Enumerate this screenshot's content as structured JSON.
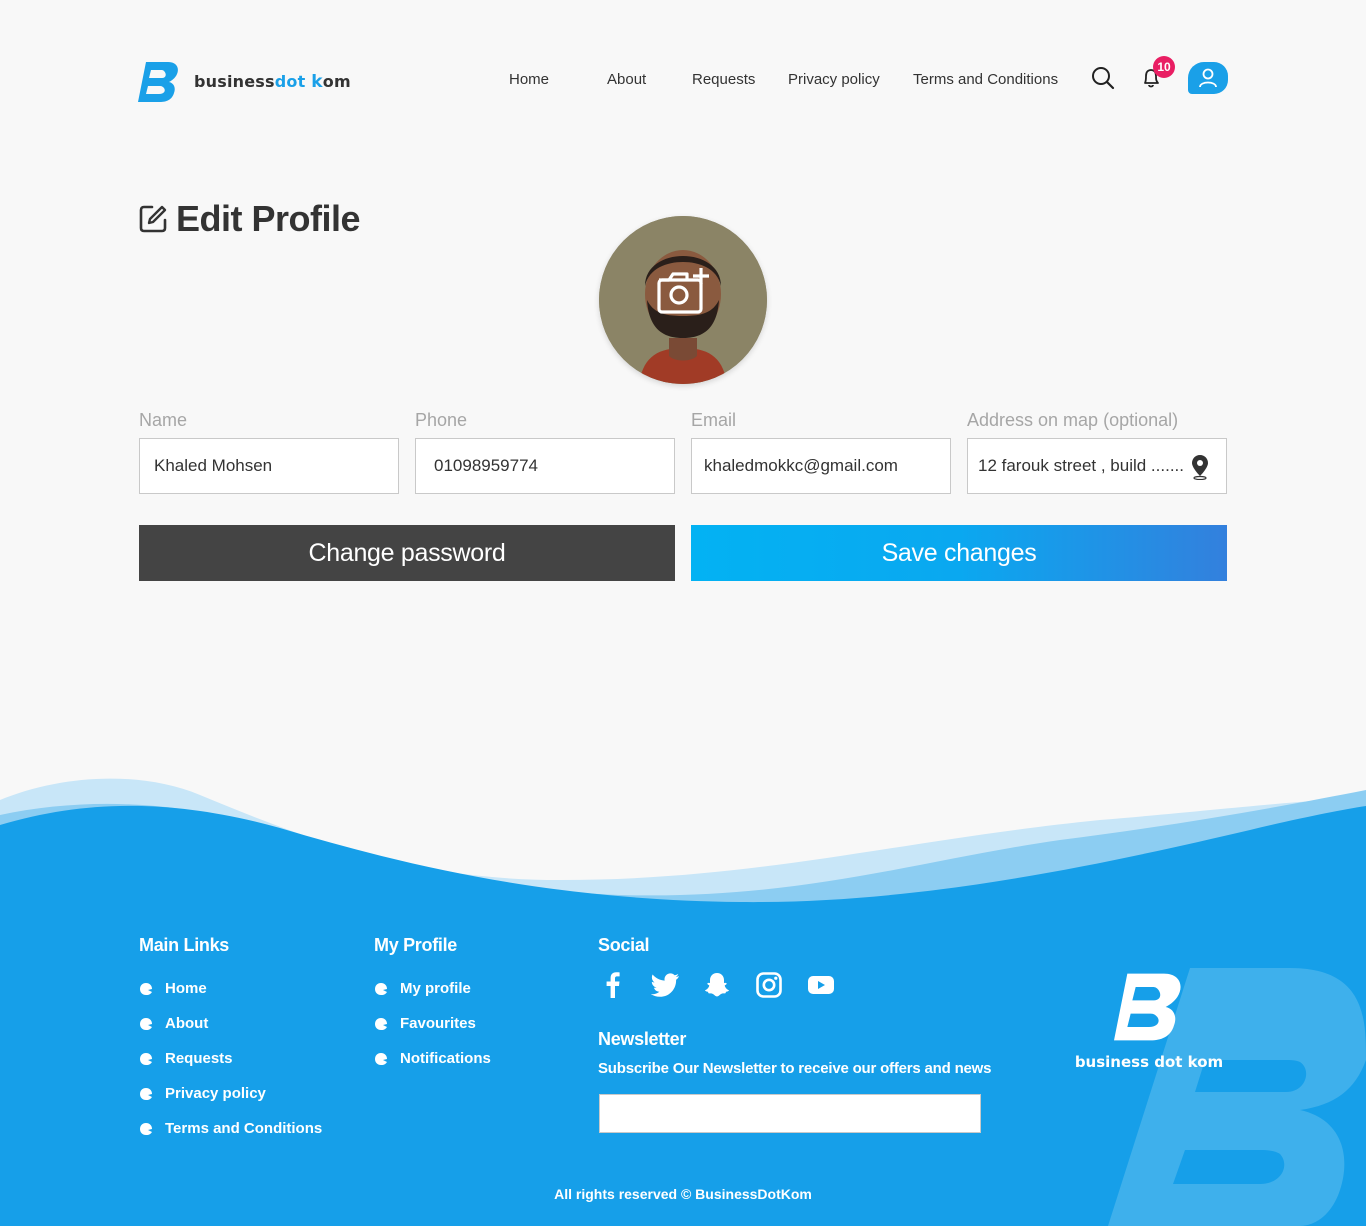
{
  "brand": {
    "word1": "business",
    "word2": "dot",
    "word3": "kom"
  },
  "nav": {
    "items": [
      {
        "label": "Home"
      },
      {
        "label": "About"
      },
      {
        "label": "Requests"
      },
      {
        "label": "Privacy policy"
      },
      {
        "label": "Terms and Conditions"
      }
    ],
    "notification_count": "10"
  },
  "page": {
    "title": "Edit Profile"
  },
  "form": {
    "name": {
      "label": "Name",
      "value": "Khaled Mohsen"
    },
    "phone": {
      "label": "Phone",
      "value": "01098959774"
    },
    "email": {
      "label": "Email",
      "value": "khaledmokkc@gmail.com"
    },
    "address": {
      "label": "Address on map (optional)",
      "value": "12 farouk street , build ......."
    },
    "change_password_label": "Change password",
    "save_label": "Save changes"
  },
  "footer": {
    "main_links": {
      "heading": "Main Links",
      "items": [
        "Home",
        "About",
        "Requests",
        "Privacy policy",
        "Terms and Conditions"
      ]
    },
    "my_profile": {
      "heading": "My Profile",
      "items": [
        "My profile",
        "Favourites",
        "Notifications"
      ]
    },
    "social": {
      "heading": "Social",
      "icons": [
        "facebook-icon",
        "twitter-icon",
        "snapchat-icon",
        "instagram-icon",
        "youtube-icon"
      ]
    },
    "newsletter": {
      "heading": "Newsletter",
      "subtitle": "Subscribe Our Newsletter to receive our offers and news",
      "placeholder": ""
    },
    "logo_text": "business dot kom",
    "copyright": "All rights reserved © BusinessDotKom"
  },
  "colors": {
    "primary": "#1aa0e8",
    "dark": "#444444",
    "badge": "#e91e63",
    "footer": "#169fe9"
  }
}
